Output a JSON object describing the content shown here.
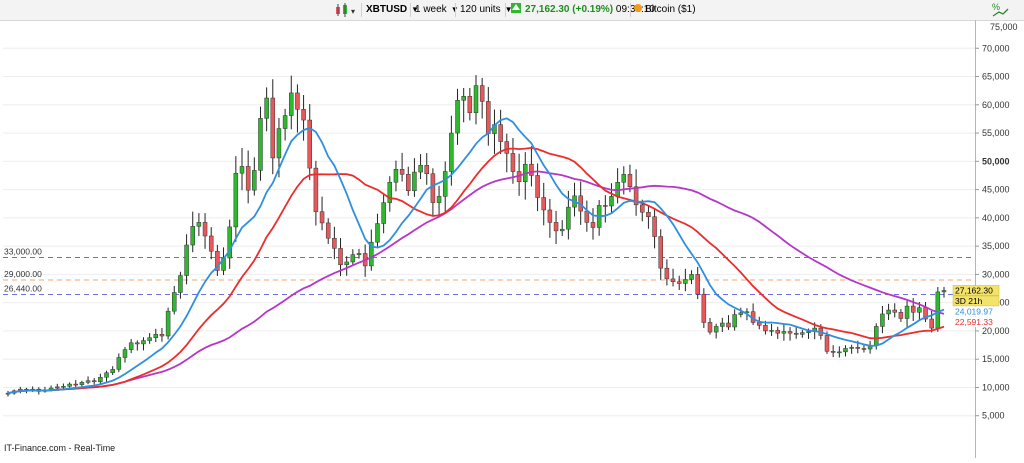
{
  "toolbar": {
    "symbol": "XBTUSD",
    "interval": "1 week",
    "units": "120 units",
    "price": "27,162.30",
    "change": "(+0.19%)",
    "time": "09:33:10",
    "instrument": "Bitcoin ($1)",
    "corner_value": "75,000"
  },
  "footer": {
    "source": "IT-Finance.com - Real-Time"
  },
  "colors": {
    "up": "#2fb82f",
    "down": "#e8585a",
    "ma_fast": "#2f8fe0",
    "ma_mid": "#ee2c2c",
    "ma_slow": "#b536c8",
    "level_green": "#3aa63a",
    "level_orange": "#f3a36a",
    "level_blue": "#7070e0",
    "price_label_bg": "#f2e36a"
  },
  "chart_data": {
    "type": "candlestick",
    "ylim": [
      0,
      75000
    ],
    "yticks": [
      "5,000",
      "10,000",
      "15,000",
      "20,000",
      "25,000",
      "30,000",
      "35,000",
      "40,000",
      "45,000",
      "50,000",
      "55,000",
      "60,000",
      "65,000",
      "70,000"
    ],
    "ytick_values": [
      5000,
      10000,
      15000,
      20000,
      25000,
      30000,
      35000,
      40000,
      45000,
      50000,
      55000,
      60000,
      65000,
      70000
    ],
    "levels": [
      {
        "label": "33,000.00",
        "value": 33000,
        "color": "#3aa63a"
      },
      {
        "label": "29,000.00",
        "value": 29000,
        "color": "#f3a36a"
      },
      {
        "label": "26,440.00",
        "value": 26440,
        "color": "#7070e0"
      }
    ],
    "last_labels": [
      {
        "text": "27,162.30",
        "value": 27162.3,
        "kind": "price"
      },
      {
        "text": "3D 21h",
        "value": 25800,
        "kind": "countdown"
      },
      {
        "text": "24,019.97",
        "value": 24019.97,
        "kind": "ma_fast"
      },
      {
        "text": "22,591.33",
        "value": 22591.33,
        "kind": "ma_mid"
      }
    ],
    "closes": [
      9000,
      9400,
      9700,
      9600,
      9700,
      9300,
      9600,
      9900,
      10100,
      10200,
      10600,
      10500,
      10900,
      11200,
      11000,
      11800,
      12600,
      13200,
      15300,
      16700,
      17900,
      17700,
      18300,
      18800,
      19400,
      19100,
      23500,
      26800,
      29800,
      35200,
      38500,
      39200,
      36800,
      34100,
      30700,
      32900,
      38400,
      47900,
      49100,
      44900,
      48400,
      57600,
      61200,
      50600,
      55800,
      58100,
      62100,
      59200,
      57300,
      48800,
      41100,
      39100,
      36400,
      34600,
      31700,
      32200,
      33500,
      33700,
      31500,
      35700,
      39000,
      42700,
      46300,
      48600,
      47700,
      44800,
      48100,
      49300,
      47800,
      42700,
      43800,
      48200,
      55000,
      60800,
      61500,
      58600,
      63400,
      60600,
      54900,
      56500,
      53500,
      51400,
      48200,
      46400,
      49500,
      47500,
      43600,
      41400,
      39200,
      37700,
      38000,
      41900,
      43900,
      41200,
      39200,
      38300,
      42200,
      42100,
      43800,
      46300,
      47700,
      45500,
      42300,
      41000,
      40200,
      36700,
      31100,
      29200,
      28700,
      28400,
      29100,
      30000,
      26500,
      21500,
      19800,
      20800,
      21400,
      20700,
      22900,
      23200,
      23400,
      21500,
      21000,
      20000,
      20100,
      19600,
      19900,
      19600,
      19400,
      19700,
      19900,
      20500,
      19200,
      16400,
      16200,
      16300,
      16900,
      17100,
      16900,
      16800,
      17400,
      20800,
      23000,
      23700,
      23300,
      22200,
      24400,
      23300,
      24100,
      22100,
      20500,
      26900,
      27162
    ]
  }
}
